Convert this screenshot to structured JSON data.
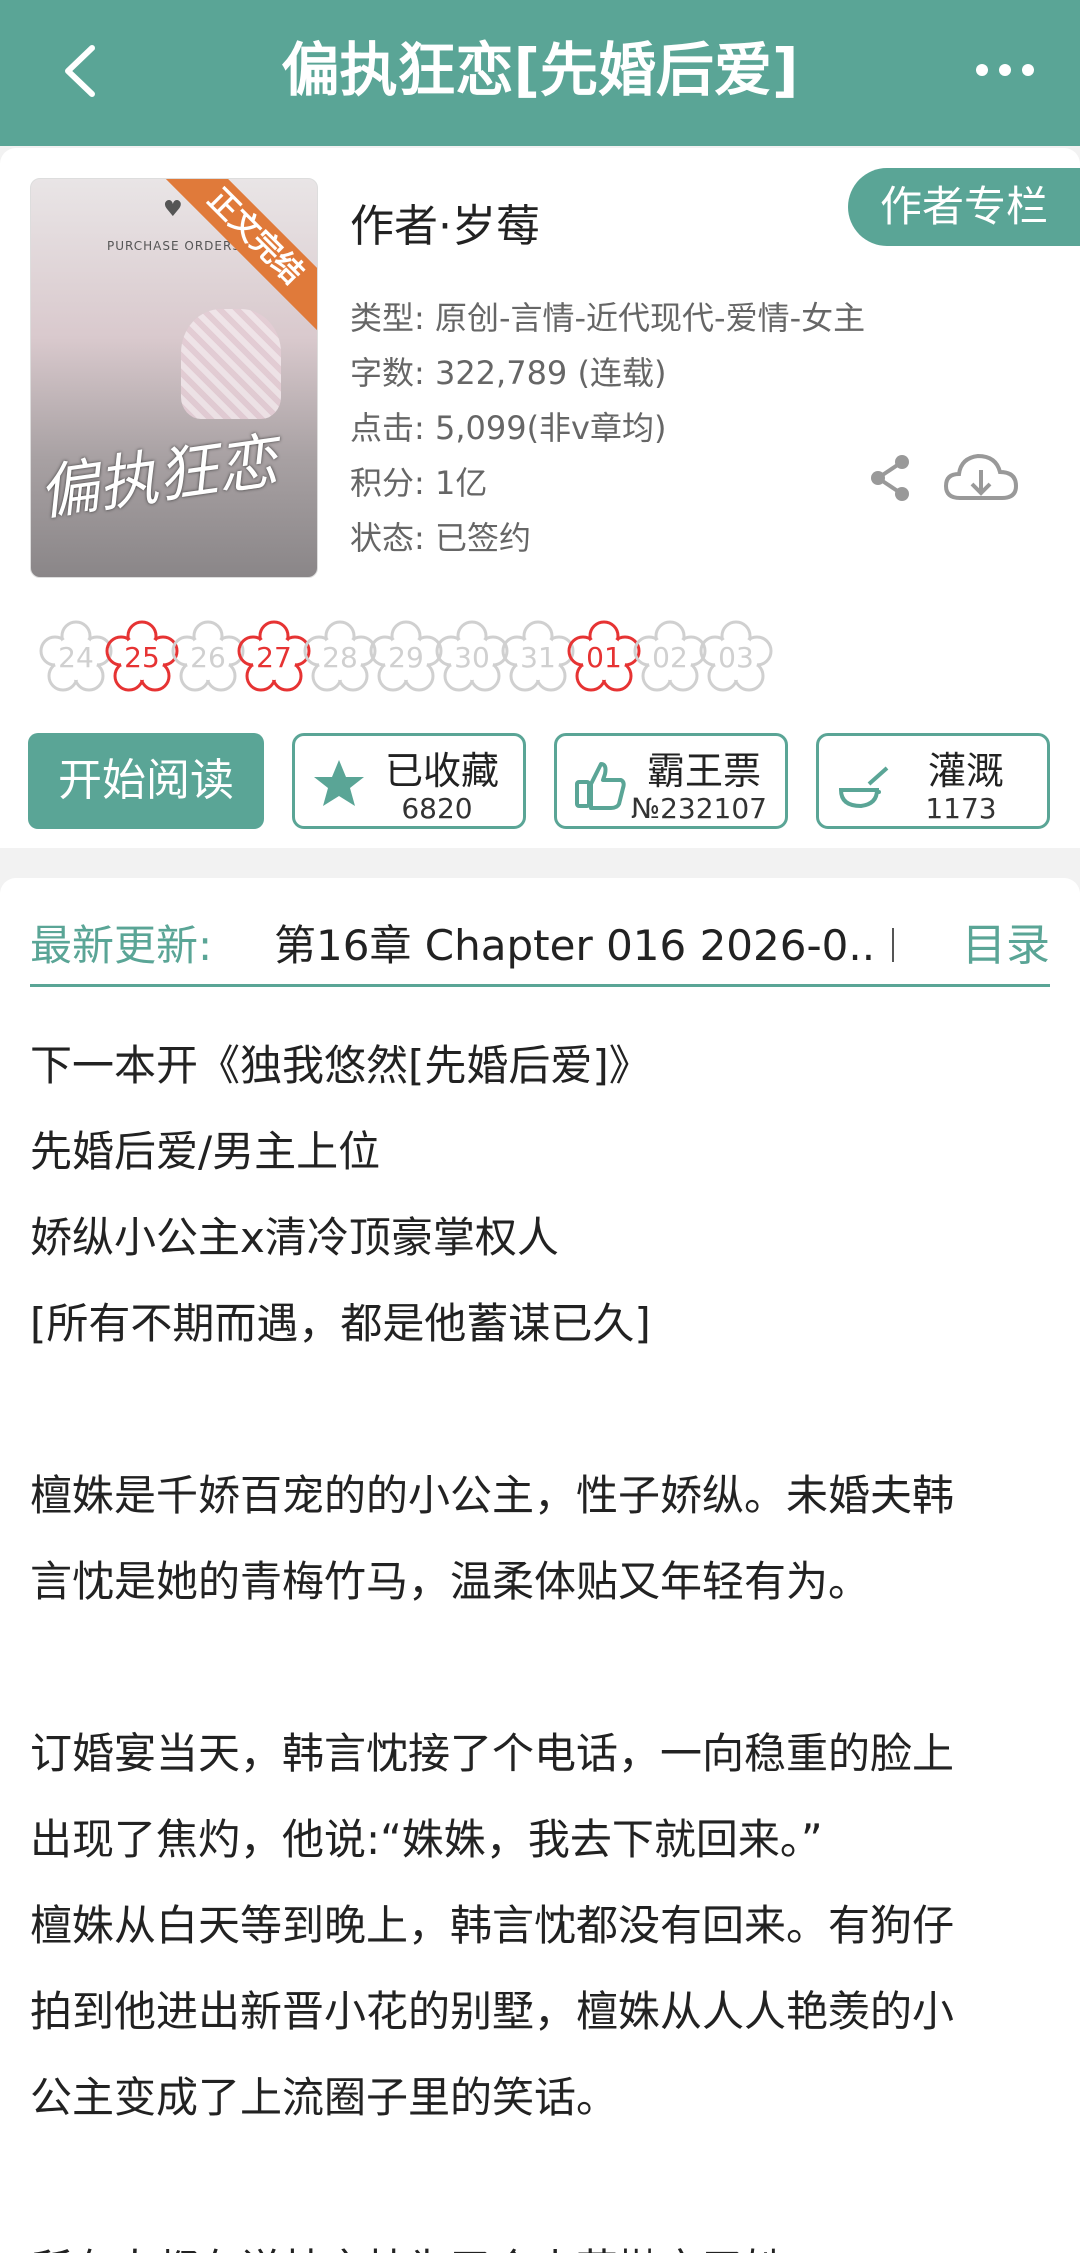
{
  "header": {
    "title": "偏执狂恋[先婚后爱]"
  },
  "cover": {
    "ribbon": "正文完结",
    "subtitle": "PURCHASE ORDERS",
    "calligraphy": "偏执狂恋"
  },
  "book": {
    "author_line": "作者·岁莓",
    "author_column_label": "作者专栏",
    "genre": "类型: 原创-言情-近代现代-爱情-女主",
    "words": "字数: 322,789 (连载)",
    "clicks": "点击: 5,099(非v章均)",
    "score": "积分: 1亿",
    "status": "状态: 已签约"
  },
  "flowers": [
    {
      "day": "24",
      "active": false
    },
    {
      "day": "25",
      "active": true
    },
    {
      "day": "26",
      "active": false
    },
    {
      "day": "27",
      "active": true
    },
    {
      "day": "28",
      "active": false
    },
    {
      "day": "29",
      "active": false
    },
    {
      "day": "30",
      "active": false
    },
    {
      "day": "31",
      "active": false
    },
    {
      "day": "01",
      "active": true
    },
    {
      "day": "02",
      "active": false
    },
    {
      "day": "03",
      "active": false
    }
  ],
  "actions": {
    "read_label": "开始阅读",
    "collect_label": "已收藏",
    "collect_count": "6820",
    "ticket_label": "霸王票",
    "ticket_count": "№232107",
    "water_label": "灌溉",
    "water_count": "1173"
  },
  "latest": {
    "label": "最新更新:",
    "value": "第16章  Chapter 016  2026-0..",
    "toc_label": "目录"
  },
  "intro": [
    "下一本开《独我悠然[先婚后爱]》",
    "先婚后爱/男主上位",
    "娇纵小公主x清冷顶豪掌权人",
    "[所有不期而遇，都是他蓄谋已久]",
    "",
    "檀姝是千娇百宠的的小公主，性子娇纵。未婚夫韩",
    "言忱是她的青梅竹马，温柔体贴又年轻有为。",
    "",
    "订婚宴当天，韩言忱接了个电话，一向稳重的脸上",
    "出现了焦灼，他说:“姝姝，我去下就回来。”",
    "檀姝从白天等到晚上，韩言忱都没有回来。有狗仔",
    "拍到他进出新晋小花的别墅，檀姝从人人艳羡的小",
    "公主变成了上流圈子里的笑话。",
    "",
    "所有人都在说韩言忱为了个小花抛弃了她"
  ],
  "colors": {
    "accent": "#5aa596",
    "flower_active": "#e63333",
    "flower_inactive": "#d0d0d0"
  }
}
